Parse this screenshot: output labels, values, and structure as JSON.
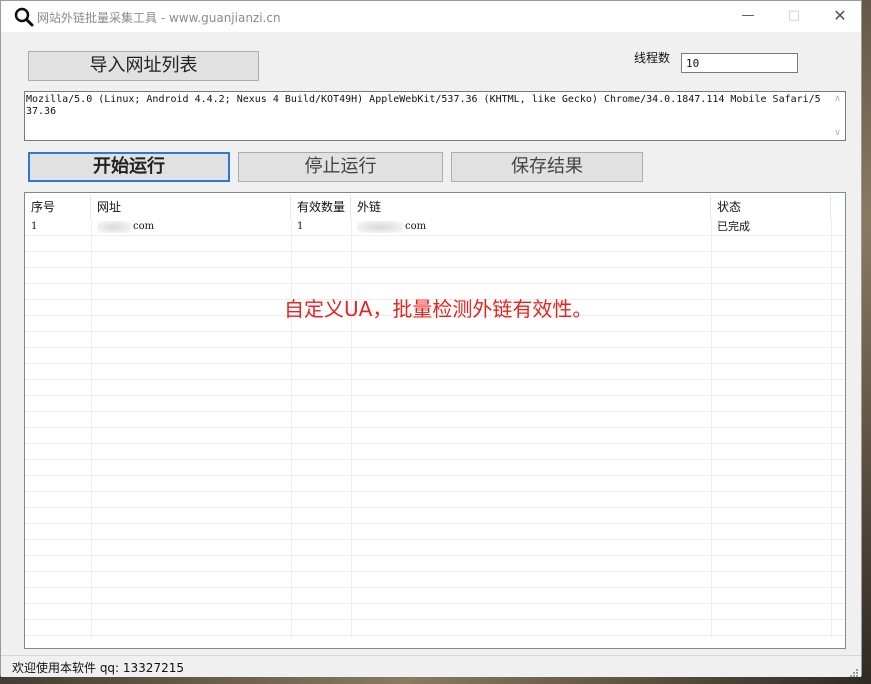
{
  "window": {
    "title": "网站外链批量采集工具 - www.guanjianzi.cn",
    "icon": "search-icon"
  },
  "toolbar": {
    "import_label": "导入网址列表",
    "thread_label": "线程数",
    "thread_value": "10",
    "start_label": "开始运行",
    "stop_label": "停止运行",
    "save_label": "保存结果"
  },
  "ua": {
    "value": "Mozilla/5.0 (Linux; Android 4.4.2; Nexus 4 Build/KOT49H) AppleWebKit/537.36 (KHTML, like Gecko) Chrome/34.0.1847.114 Mobile Safari/537.36"
  },
  "table": {
    "columns": [
      "序号",
      "网址",
      "有效数量",
      "外链",
      "状态"
    ],
    "rows": [
      {
        "index": "1",
        "url": "com",
        "count": "1",
        "link": "com",
        "status": "已完成"
      }
    ]
  },
  "annotation": "自定义UA，批量检测外链有效性。",
  "status": {
    "text": "欢迎使用本软件 qq: 13327215"
  },
  "colors": {
    "accent": "#2a7ad3",
    "annotation": "#e8231f"
  }
}
